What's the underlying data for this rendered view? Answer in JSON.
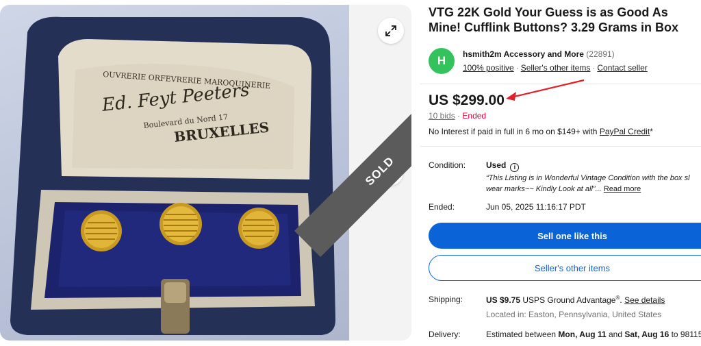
{
  "gallery": {
    "expand_icon": "expand-arrows-icon",
    "next_icon": "chevron-right-icon",
    "sold_banner": "SOLD",
    "image_texts": {
      "line1": "OUVRERIE ORFEVRERIE MAROQUINERIE",
      "line2": "Ed. Feyt Peeters",
      "line3": "Boulevard du Nord 17",
      "line4": "BRUXELLES"
    }
  },
  "listing": {
    "title": "VTG 22K Gold Your Guess is as Good As Mine! Cufflink Buttons? 3.29 Grams in Box"
  },
  "seller": {
    "avatar_letter": "H",
    "name": "hsmith2m Accessory and More",
    "feedback_count": "(22891)",
    "positive": "100% positive",
    "other_items": "Seller's other items",
    "contact": "Contact seller"
  },
  "price": {
    "amount": "US $299.00",
    "bids": "10 bids",
    "separator": "·",
    "status": "Ended",
    "financing_prefix": "No Interest if paid in full in 6 mo on $149+ with ",
    "financing_link": "PayPal Credit",
    "financing_suffix": "*"
  },
  "details": {
    "condition_label": "Condition:",
    "condition_value": "Used",
    "condition_desc_line1": "“This Listing is in Wonderful Vintage Condition with the box sl",
    "condition_desc_line2_pre": "wear marks~~ Kindly Look at all”...",
    "read_more": "Read more",
    "ended_label": "Ended:",
    "ended_value": "Jun 05, 2025 11:16:17 PDT"
  },
  "buttons": {
    "sell_like_this": "Sell one like this",
    "sellers_other_items": "Seller's other items"
  },
  "shipping": {
    "label": "Shipping:",
    "cost": "US $9.75",
    "service": "USPS Ground Advantage",
    "registered": "®",
    "see_details": "See details",
    "located": "Located in: Easton, Pennsylvania, United States"
  },
  "delivery": {
    "label": "Delivery:",
    "prefix": "Estimated between ",
    "date1": "Mon, Aug 11",
    "and": " and ",
    "date2": "Sat, Aug 16",
    "to": " to 98115"
  },
  "colors": {
    "accent_blue": "#0a64d8",
    "ended_red": "#e0003c",
    "avatar_green": "#34c25c",
    "annotation_arrow": "#e0202a"
  }
}
